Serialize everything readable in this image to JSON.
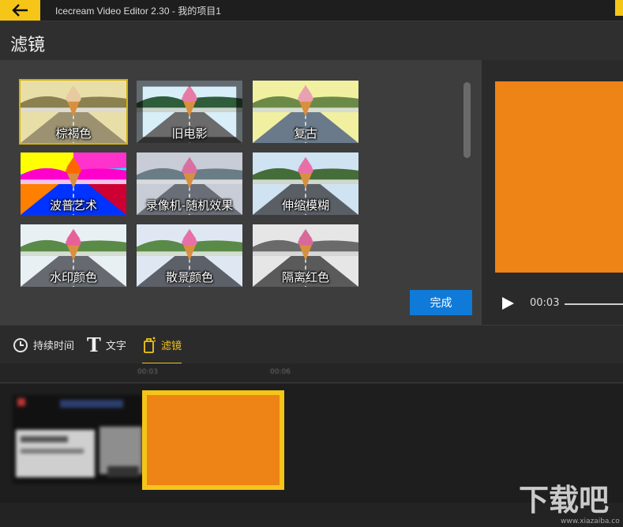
{
  "app": {
    "window_title": "Icecream Video Editor 2.30",
    "title_separator": " - ",
    "project_name": "我的项目1"
  },
  "header": {
    "title": "滤镜"
  },
  "filters": [
    {
      "label": "棕褐色",
      "style": "sepia",
      "selected": true
    },
    {
      "label": "旧电影",
      "style": "old-film",
      "selected": false
    },
    {
      "label": "复古",
      "style": "retro",
      "selected": false
    },
    {
      "label": "波普艺术",
      "style": "pop-art",
      "selected": false
    },
    {
      "label": "录像机-随机效果",
      "style": "vhs",
      "selected": false
    },
    {
      "label": "伸缩模糊",
      "style": "zoom-blur",
      "selected": false
    },
    {
      "label": "水印颜色",
      "style": "watercolor",
      "selected": false
    },
    {
      "label": "散景颜色",
      "style": "bokeh",
      "selected": false
    },
    {
      "label": "隔离红色",
      "style": "isolate-red",
      "selected": false
    }
  ],
  "done_button": {
    "label": "完成"
  },
  "player": {
    "time": "00:03"
  },
  "tabs": [
    {
      "label": "持续时间",
      "icon": "clock-icon",
      "active": false
    },
    {
      "label": "文字",
      "icon": "text-icon",
      "active": false
    },
    {
      "label": "滤镜",
      "icon": "filter-icon",
      "active": true
    }
  ],
  "timeline": {
    "ticks": [
      "00:03",
      "00:06"
    ]
  },
  "colors": {
    "accent": "#f5c518",
    "done_button": "#0f7ad8",
    "preview_fill": "#ee8316"
  },
  "watermark": {
    "text": "下载吧",
    "url_text": "www.xiazaiba.com"
  }
}
